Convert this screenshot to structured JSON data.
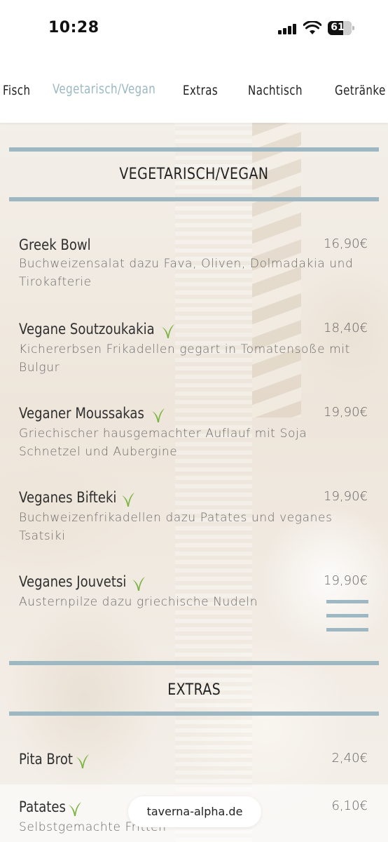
{
  "status_bar": {
    "time": "10:28",
    "battery": "61"
  },
  "categories": [
    {
      "label": "Fisch",
      "active": false
    },
    {
      "label": "Vegetarisch/Vegan",
      "active": true
    },
    {
      "label": "Extras",
      "active": false
    },
    {
      "label": "Nachtisch",
      "active": false
    },
    {
      "label": "Getränke",
      "active": false
    }
  ],
  "sections": [
    {
      "title": "VEGETARISCH/VEGAN",
      "items": [
        {
          "name": "Greek Bowl",
          "vegan_icon": false,
          "price": "16,90€",
          "description": "Buchweizensalat dazu Fava, Oliven, Dolmadakia und Tirokafterie"
        },
        {
          "name": "Vegane Soutzoukakia",
          "vegan_icon": true,
          "price": "18,40€",
          "description": "Kichererbsen Frikadellen gegart in Tomatensoße mit Bulgur"
        },
        {
          "name": "Veganer Moussakas",
          "vegan_icon": true,
          "price": "19,90€",
          "description": "Griechischer hausgemachter Auflauf mit Soja Schnetzel und Aubergine"
        },
        {
          "name": "Veganes Bifteki",
          "vegan_icon": true,
          "price": "19,90€",
          "description": "Buchweizenfrikadellen dazu Patates und veganes Tsatsiki"
        },
        {
          "name": "Veganes Jouvetsi",
          "vegan_icon": true,
          "price": "19,90€",
          "description": "Austernpilze dazu griechische Nudeln"
        }
      ]
    },
    {
      "title": "EXTRAS",
      "items": [
        {
          "name": "Pita Brot",
          "vegan_icon": true,
          "price": "2,40€",
          "description": ""
        },
        {
          "name": "Patates",
          "vegan_icon": true,
          "price": "6,10€",
          "description": "Selbstgemachte Fritten"
        }
      ]
    }
  ],
  "browser": {
    "url": "taverna-alpha.de"
  },
  "colors": {
    "accent": "#9db7c3",
    "vegan_icon": "#7cb342"
  }
}
